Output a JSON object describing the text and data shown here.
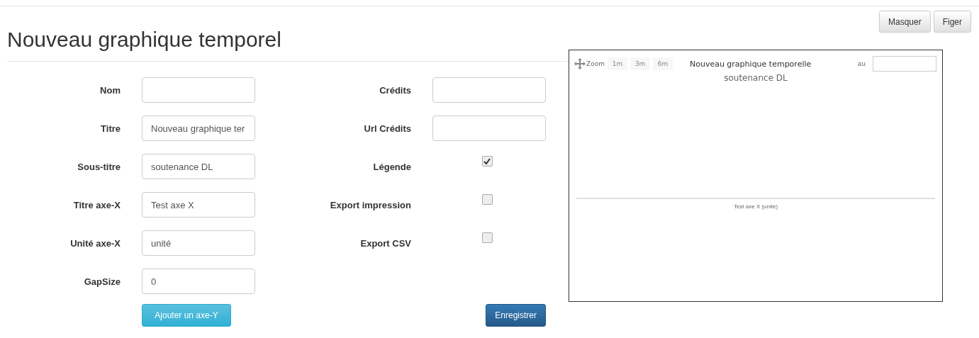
{
  "title": "Nouveau graphique temporel",
  "top_buttons": [
    "Masquer",
    "Figer"
  ],
  "left_fields": [
    {
      "label": "Nom"
    },
    {
      "label": "Titre",
      "value": "Nouveau graphique ter"
    },
    {
      "label": "Sous-titre",
      "value": "soutenance DL"
    },
    {
      "label": "Titre axe-X",
      "value": "Test axe X"
    },
    {
      "label": "Unité axe-X",
      "value": "unité"
    },
    {
      "label": "GapSize",
      "value": "0"
    }
  ],
  "right_fields": [
    {
      "label": "Crédits",
      "kind": "text"
    },
    {
      "label": "Url Crédits",
      "kind": "text"
    },
    {
      "label": "Légende",
      "kind": "checkbox",
      "checked": true
    },
    {
      "label": "Export impression",
      "kind": "checkbox",
      "checked": false
    },
    {
      "label": "Export CSV",
      "kind": "checkbox",
      "checked": false
    }
  ],
  "add_axis_button": "Ajouter un axe-Y",
  "save_button": "Enregistrer",
  "preview": {
    "zoom_label": "Zoom",
    "zoom_buttons": [
      "1m",
      "3m",
      "6m"
    ],
    "to_label": "au",
    "title": "Nouveau graphique temporelle",
    "subtitle": "soutenance DL",
    "x_axis_title": "Test axe X (unité)"
  }
}
